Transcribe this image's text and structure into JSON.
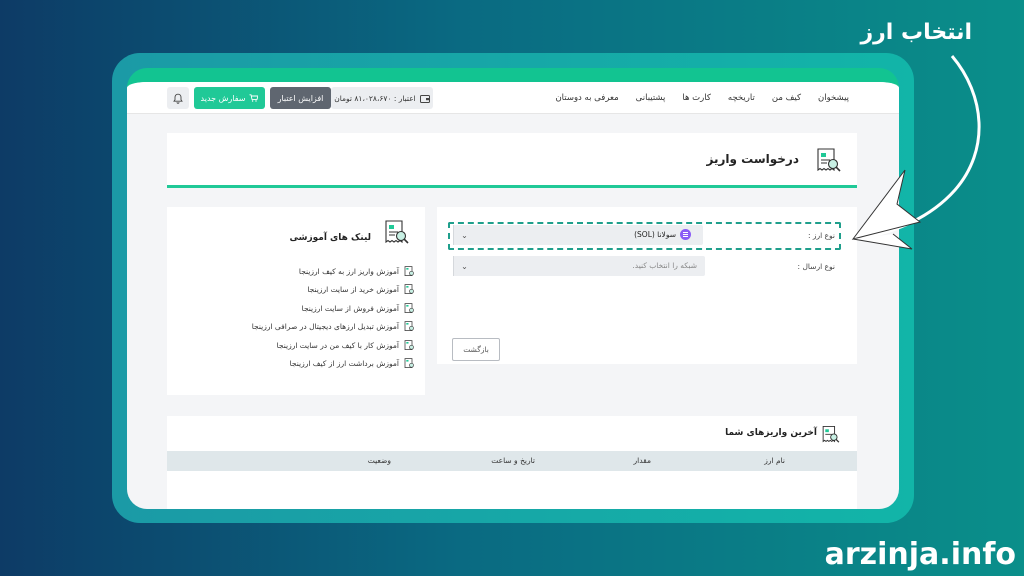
{
  "annotation": {
    "headline": "انتخاب ارز",
    "watermark": "arzinja.info"
  },
  "nav": {
    "items": [
      "پیشخوان",
      "کیف من",
      "تاریخچه",
      "کارت ها",
      "پشتیبانی",
      "معرفی به دوستان"
    ]
  },
  "header": {
    "credit_text": "اعتبار : ۸۱،۰۲۸،۶۷۰ تومان",
    "increase_credit": "افزایش اعتبار",
    "new_order": "سفارش جدید"
  },
  "page": {
    "title": "درخواست واریز"
  },
  "links_panel": {
    "title": "لینک های آموزشی",
    "links": [
      "آموزش واریز ارز به کیف ارزینجا",
      "آموزش خرید از سایت ارزینجا",
      "آموزش فروش از سایت ارزینجا",
      "آموزش تبدیل ارزهای دیجیتال در صرافی ارزینجا",
      "آموزش کار با کیف من در سایت ارزینجا",
      "آموزش برداشت ارز از کیف ارزینجا"
    ]
  },
  "form": {
    "currency_label": "نوع ارز :",
    "currency_value": "سولانا (SOL)",
    "network_label": "نوع ارسال :",
    "network_placeholder": "شبکه را انتخاب کنید.",
    "back_button": "بازگشت"
  },
  "recent": {
    "title": "آخرین واریزهای شما",
    "columns": [
      "نام ارز",
      "مقدار",
      "تاریخ و ساعت",
      "وضعیت"
    ],
    "rows": []
  },
  "colors": {
    "accent": "#20c997",
    "dark_button": "#5f6670",
    "highlight": "#1f9f8c",
    "solana": "#8a5cf6"
  },
  "icons": [
    "wallet-icon",
    "cart-icon",
    "bell-icon",
    "document-search-icon",
    "chevron-down-icon",
    "solana-icon",
    "pointer-arrow-icon"
  ]
}
